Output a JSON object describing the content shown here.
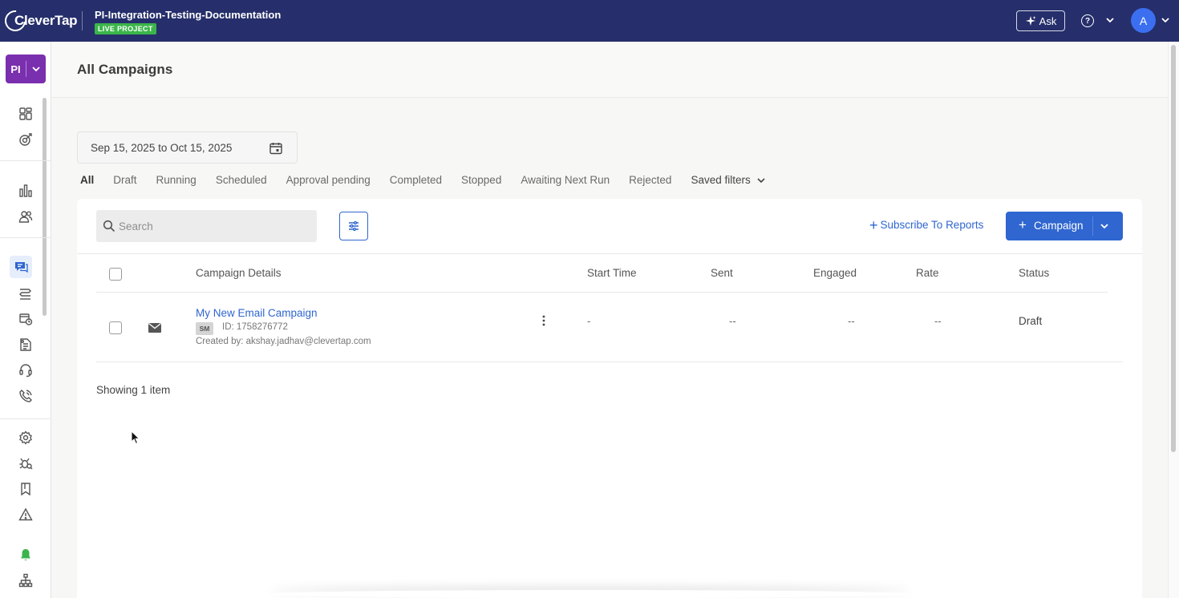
{
  "app": {
    "brand": "CleverTap",
    "project_name": "PI-Integration-Testing-Documentation",
    "project_badge": "LIVE PROJECT",
    "ask_label": "Ask",
    "avatar_initial": "A",
    "project_switcher_label": "PI"
  },
  "sidebar": {
    "icons": [
      "dashboard-icon",
      "analytics-target-icon",
      "bar-chart-icon",
      "users-icon",
      "campaigns-icon",
      "journeys-icon",
      "schedule-icon",
      "catalog-icon",
      "support-icon",
      "call-icon",
      "settings-icon",
      "debug-icon",
      "bookmark-icon",
      "alert-icon",
      "notification-bell-icon",
      "hierarchy-icon"
    ],
    "active": "campaigns-icon"
  },
  "page": {
    "title": "All Campaigns"
  },
  "date_range": {
    "value": "Sep 15, 2025 to Oct 15, 2025"
  },
  "tabs": [
    {
      "label": "All",
      "active": true
    },
    {
      "label": "Draft"
    },
    {
      "label": "Running"
    },
    {
      "label": "Scheduled"
    },
    {
      "label": "Approval pending"
    },
    {
      "label": "Completed"
    },
    {
      "label": "Stopped"
    },
    {
      "label": "Awaiting Next Run"
    },
    {
      "label": "Rejected"
    }
  ],
  "saved_filters_label": "Saved filters",
  "toolbar": {
    "search_placeholder": "Search",
    "subscribe_label": "Subscribe To Reports",
    "campaign_label": "Campaign"
  },
  "table": {
    "headers": {
      "details": "Campaign Details",
      "start_time": "Start Time",
      "sent": "Sent",
      "engaged": "Engaged",
      "rate": "Rate",
      "status": "Status"
    },
    "rows": [
      {
        "name": "My New Email Campaign",
        "badge": "SM",
        "id": "ID: 1758276772",
        "created_by": "Created by: akshay.jadhav@clevertap.com",
        "start_time": "-",
        "sent": "--",
        "engaged": "--",
        "rate": "--",
        "status": "Draft"
      }
    ]
  },
  "footer": {
    "showing": "Showing 1 item"
  },
  "colors": {
    "topbar": "#262f6b",
    "accent": "#2f66d0",
    "live_badge": "#3bb54a",
    "project_switcher": "#7a2fae"
  }
}
